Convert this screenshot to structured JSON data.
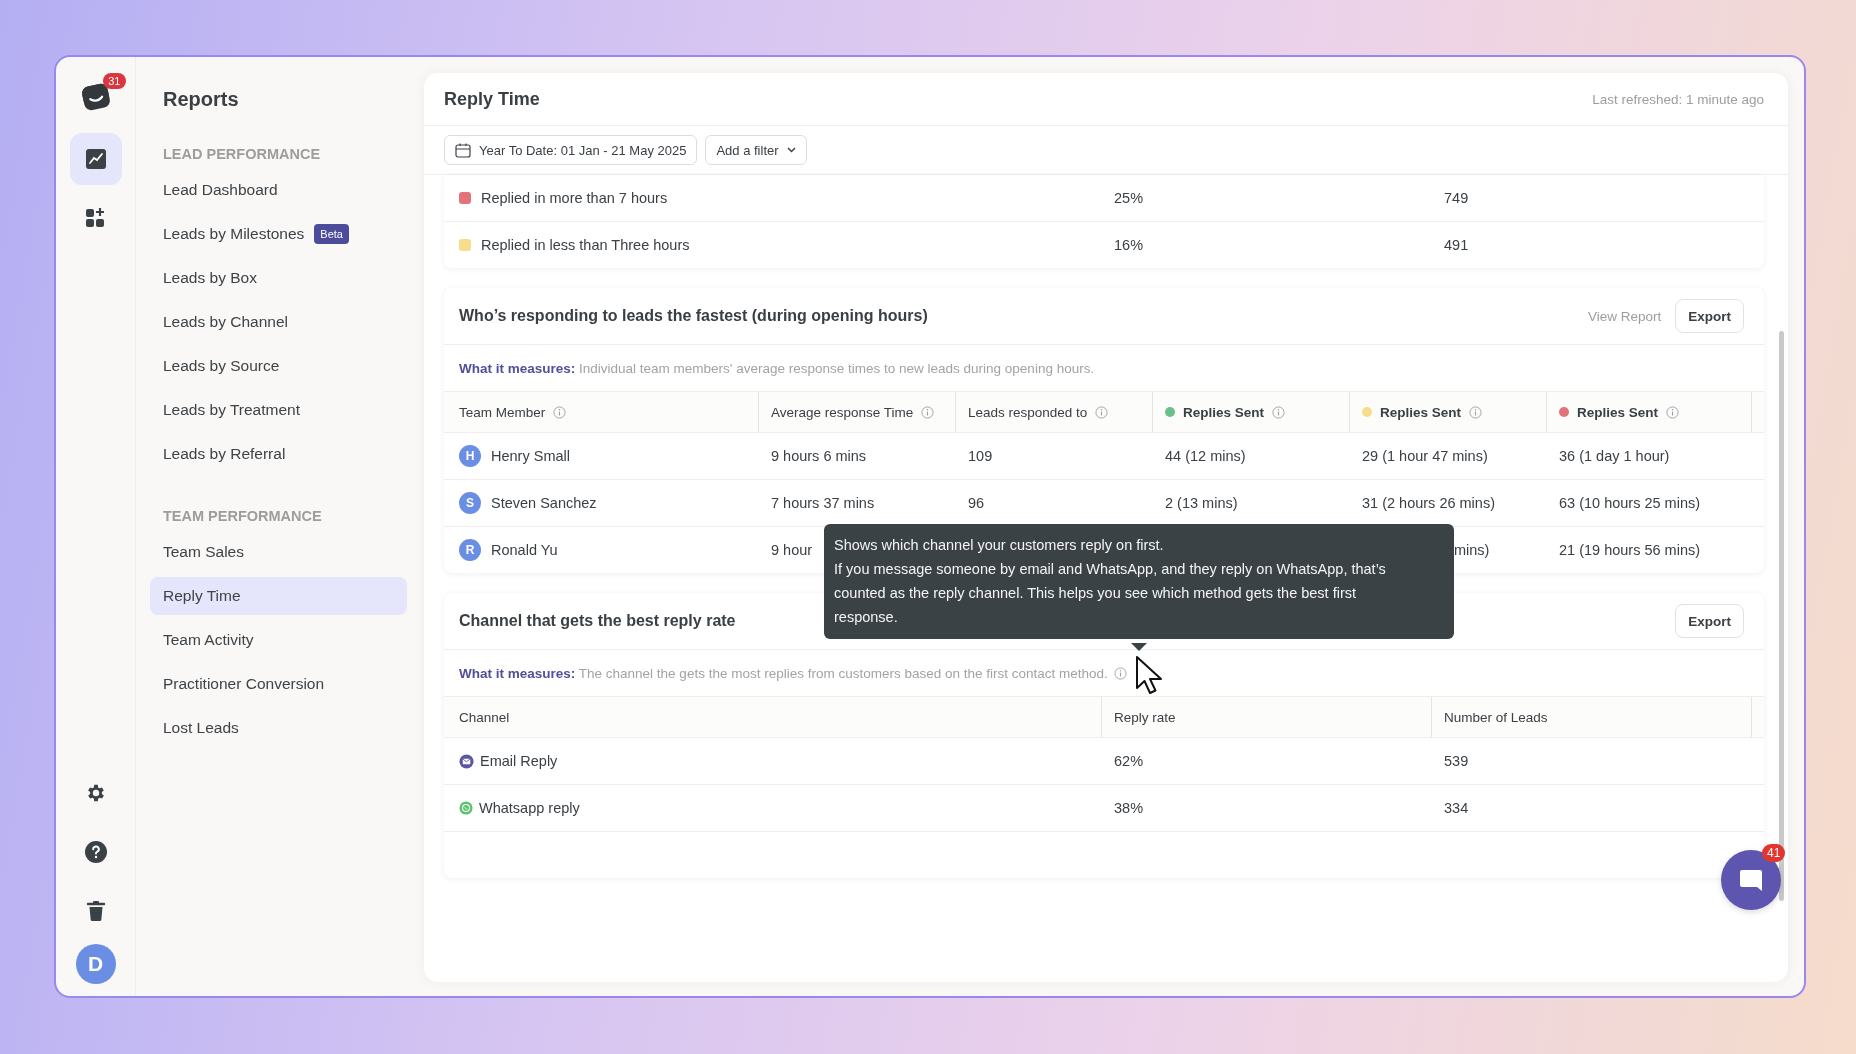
{
  "rail": {
    "logo_badge": "31",
    "items": [
      {
        "kind": "chart",
        "selected": true
      },
      {
        "kind": "apps",
        "selected": false
      }
    ],
    "bottom": [
      {
        "kind": "settings"
      },
      {
        "kind": "help"
      },
      {
        "kind": "trash"
      }
    ],
    "avatar": "D"
  },
  "sidebar": {
    "title": "Reports",
    "sections": [
      {
        "heading": "LEAD PERFORMANCE",
        "items": [
          {
            "label": "Lead Dashboard",
            "selected": false
          },
          {
            "label": "Leads by Milestones",
            "selected": false,
            "badge": "Beta"
          },
          {
            "label": "Leads by Box",
            "selected": false
          },
          {
            "label": "Leads by Channel",
            "selected": false
          },
          {
            "label": "Leads by Source",
            "selected": false
          },
          {
            "label": "Leads by Treatment",
            "selected": false
          },
          {
            "label": "Leads by Referral",
            "selected": false
          }
        ]
      },
      {
        "heading": "TEAM PERFORMANCE",
        "items": [
          {
            "label": "Team Sales",
            "selected": false
          },
          {
            "label": "Reply Time",
            "selected": true
          },
          {
            "label": "Team Activity",
            "selected": false
          },
          {
            "label": "Practitioner Conversion",
            "selected": false
          },
          {
            "label": "Lost Leads",
            "selected": false
          }
        ]
      }
    ]
  },
  "main": {
    "title": "Reply Time",
    "last_refreshed": "Last refreshed: 1 minute ago",
    "date_range": "Year To Date: 01 Jan - 21 May 2025",
    "add_filter": "Add a filter"
  },
  "summary_rows": [
    {
      "color": "#e2737b",
      "label": "Replied in more than 7 hours",
      "share": "25%",
      "count": "749"
    },
    {
      "color": "#f7dc8c",
      "label": "Replied in less than Three hours",
      "share": "16%",
      "count": "491"
    }
  ],
  "responders": {
    "title": "Who’s responding to leads the fastest (during opening hours)",
    "actions": [
      {
        "kind": "link",
        "label": "View Report"
      },
      {
        "kind": "button",
        "label": "Export"
      }
    ],
    "measures_label": "What it measures:",
    "measures_text": "Individual team members' average response times to new leads during opening hours.",
    "columns": [
      {
        "label": "Team Member",
        "info": true
      },
      {
        "label": "Average response Time",
        "info": true
      },
      {
        "label": "Leads responded to",
        "info": true
      },
      {
        "label": "Replies Sent",
        "info": true,
        "color": "#6cbf8c"
      },
      {
        "label": "Replies Sent",
        "info": true,
        "color": "#f7dc8c"
      },
      {
        "label": "Replies Sent",
        "info": true,
        "color": "#e2737b"
      }
    ],
    "rows": [
      {
        "initial": "H",
        "name": "Henry Small",
        "avg": "9 hours 6 mins",
        "leads": "109",
        "fast": "44 (12 mins)",
        "medium": "29 (1 hour 47 mins)",
        "slow": "36 (1 day 1 hour)"
      },
      {
        "initial": "S",
        "name": "Steven Sanchez",
        "avg": "7 hours 37 mins",
        "leads": "96",
        "fast": "2 (13 mins)",
        "medium": "31 (2 hours 26 mins)",
        "slow": "63 (10 hours 25 mins)"
      },
      {
        "initial": "R",
        "name": "Ronald Yu",
        "avg": "9 hour",
        "medium": "mins)",
        "slow": "21 (19 hours 56 mins)",
        "covered": true
      }
    ]
  },
  "channels": {
    "title": "Channel that gets the best reply rate",
    "actions": [
      {
        "kind": "button",
        "label": "Export"
      }
    ],
    "measures_label": "What it measures:",
    "measures_text": "The channel the gets the most replies from customers based on the first contact method.",
    "measures_info": true,
    "columns": [
      {
        "label": "Channel"
      },
      {
        "label": "Reply rate"
      },
      {
        "label": "Number of Leads"
      }
    ],
    "rows": [
      {
        "kind": "email",
        "name": "Email Reply",
        "rate": "62%",
        "leads": "539"
      },
      {
        "kind": "whatsapp",
        "name": "Whatsapp reply",
        "rate": "38%",
        "leads": "334"
      }
    ]
  },
  "tooltip": {
    "lines": [
      "Shows which channel your customers reply on first.",
      "If you message someone by email and WhatsApp, and they reply on WhatsApp, that’s counted as the reply channel. This helps you see which method gets the best first response."
    ]
  },
  "chat": {
    "badge": "41"
  }
}
